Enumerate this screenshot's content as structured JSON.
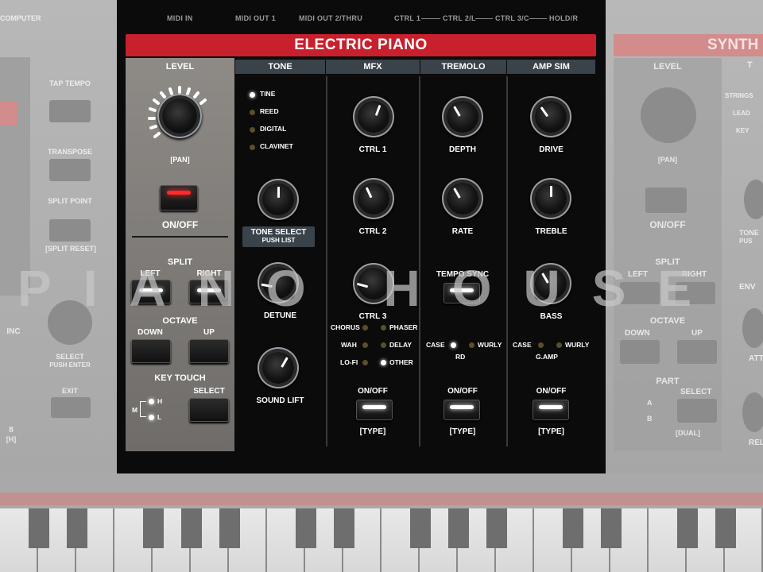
{
  "top_labels": {
    "computer": "COMPUTER",
    "midi_in": "MIDI IN",
    "midi_out1": "MIDI OUT 1",
    "midi_out2": "MIDI OUT 2/THRU",
    "ctrl1": "CTRL 1",
    "ctrl2": "CTRL 2/L",
    "ctrl3": "CTRL 3/C",
    "hold": "HOLD/R"
  },
  "section_title": "ELECTRIC PIANO",
  "headers": {
    "level": "LEVEL",
    "tone": "TONE",
    "mfx": "MFX",
    "tremolo": "TREMOLO",
    "amp_sim": "AMP SIM"
  },
  "left": {
    "pan": "[PAN]",
    "on_off": "ON/OFF",
    "split": "SPLIT",
    "left": "LEFT",
    "right": "RIGHT",
    "octave": "OCTAVE",
    "down": "DOWN",
    "up": "UP",
    "key_touch": "KEY TOUCH",
    "select": "SELECT",
    "h": "H",
    "m": "M",
    "l": "L"
  },
  "tone": {
    "types": [
      "TINE",
      "REED",
      "DIGITAL",
      "CLAVINET"
    ],
    "selected": "TINE",
    "tone_select": "TONE SELECT",
    "push_list": "PUSH LIST",
    "detune": "DETUNE",
    "sound_lift": "SOUND LIFT"
  },
  "mfx": {
    "ctrl1": "CTRL 1",
    "ctrl2": "CTRL 2",
    "ctrl3": "CTRL 3",
    "effects": [
      "CHORUS",
      "PHASER",
      "WAH",
      "DELAY",
      "LO-FI",
      "OTHER"
    ],
    "selected": "OTHER"
  },
  "tremolo": {
    "depth": "DEPTH",
    "rate": "RATE",
    "tempo_sync": "TEMPO SYNC",
    "case": "CASE",
    "wurly": "WURLY",
    "rd": "RD"
  },
  "amp_sim": {
    "drive": "DRIVE",
    "treble": "TREBLE",
    "bass": "BASS",
    "case": "CASE",
    "wurly": "WURLY",
    "g_amp": "G.AMP"
  },
  "on_off": "ON/OFF",
  "type": "[TYPE]",
  "background_left": {
    "tap_tempo": "TAP TEMPO",
    "transpose": "TRANSPOSE",
    "split_point": "SPLIT POINT",
    "split_reset": "[SPLIT RESET]",
    "inc": "INC",
    "select": "SELECT",
    "push_enter": "PUSH ENTER",
    "exit": "EXIT",
    "eight": "8",
    "h": "[H]"
  },
  "background_right": {
    "synth": "SYNTH",
    "t": "T",
    "level": "LEVEL",
    "strings": "STRINGS",
    "lead": "LEAD",
    "key": "KEY",
    "pan": "[PAN]",
    "on_off": "ON/OFF",
    "tone": "TONE",
    "pus": "PUS",
    "split": "SPLIT",
    "left": "LEFT",
    "right": "RIGHT",
    "env": "ENV",
    "octave": "OCTAVE",
    "down": "DOWN",
    "up": "UP",
    "att": "ATT",
    "part": "PART",
    "a": "A",
    "b": "B",
    "select": "SELECT",
    "dual": "[DUAL]",
    "rel": "REL"
  },
  "watermark": "PIANO HOUSE",
  "colors": {
    "accent_red": "#c8202c",
    "panel": "#0b0b0b",
    "header": "#3a424a"
  }
}
